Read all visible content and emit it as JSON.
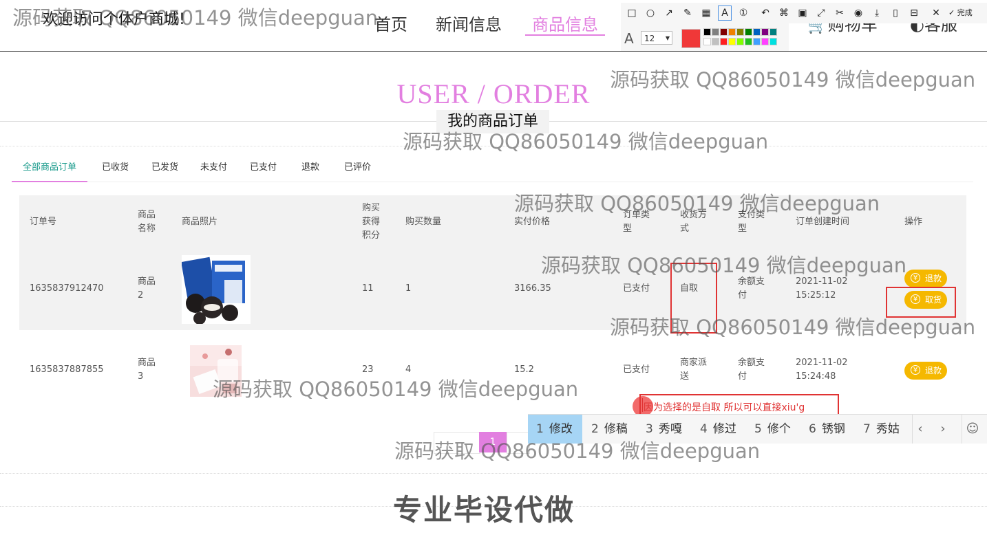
{
  "header": {
    "welcome": "欢迎访问个体户商城!",
    "nav": [
      "首页",
      "新闻信息",
      "商品信息",
      "购物车",
      "客服"
    ]
  },
  "section": {
    "title_en": "USER / ORDER",
    "title_cn": "我的商品订单"
  },
  "tabs": [
    "全部商品订单",
    "已收货",
    "已发货",
    "未支付",
    "已支付",
    "退款",
    "已评价"
  ],
  "table": {
    "headers": [
      "订单号",
      "商品名称",
      "商品照片",
      "购买获得积分",
      "购买数量",
      "实付价格",
      "订单类型",
      "收货方式",
      "支付类型",
      "订单创建时间",
      "操作"
    ],
    "rows": [
      {
        "order_no": "1635837912470",
        "name": "商品2",
        "points": "11",
        "qty": "1",
        "price": "3166.35",
        "type": "已支付",
        "delivery": "自取",
        "pay": "余额支付",
        "date": "2021-11-02",
        "time": "15:25:12",
        "actions": [
          "退款",
          "取货"
        ]
      },
      {
        "order_no": "1635837887855",
        "name": "商品3",
        "points": "23",
        "qty": "4",
        "price": "15.2",
        "type": "已支付",
        "delivery": "商家派送",
        "pay": "余额支付",
        "date": "2021-11-02",
        "time": "15:24:48",
        "actions": [
          "退款"
        ]
      }
    ]
  },
  "pagination": {
    "current": "1"
  },
  "footer": {
    "text": "专业毕设代做"
  },
  "annotation_toolbar": {
    "font_size": "12",
    "done_label": "完成",
    "current_color": "#f03838",
    "palette_top": [
      "#000000",
      "#808080",
      "#800000",
      "#f08000",
      "#808000",
      "#008000",
      "#0060c0",
      "#800080",
      "#008080"
    ],
    "palette_bottom": [
      "#ffffff",
      "#c0c0c0",
      "#ff2020",
      "#ffff00",
      "#80ff00",
      "#20c020",
      "#40a0ff",
      "#ff40ff",
      "#00e0e0"
    ]
  },
  "annotation_input": {
    "text": "因为选择的是自取 所以可以直接xiu'g"
  },
  "ime": {
    "candidates": [
      "修改",
      "修稿",
      "秀嘎",
      "修过",
      "修个",
      "锈钢",
      "秀姑"
    ],
    "numbers": [
      "1",
      "2",
      "3",
      "4",
      "5",
      "6",
      "7"
    ]
  },
  "watermark": "源码获取 QQ86050149 微信deepguan"
}
